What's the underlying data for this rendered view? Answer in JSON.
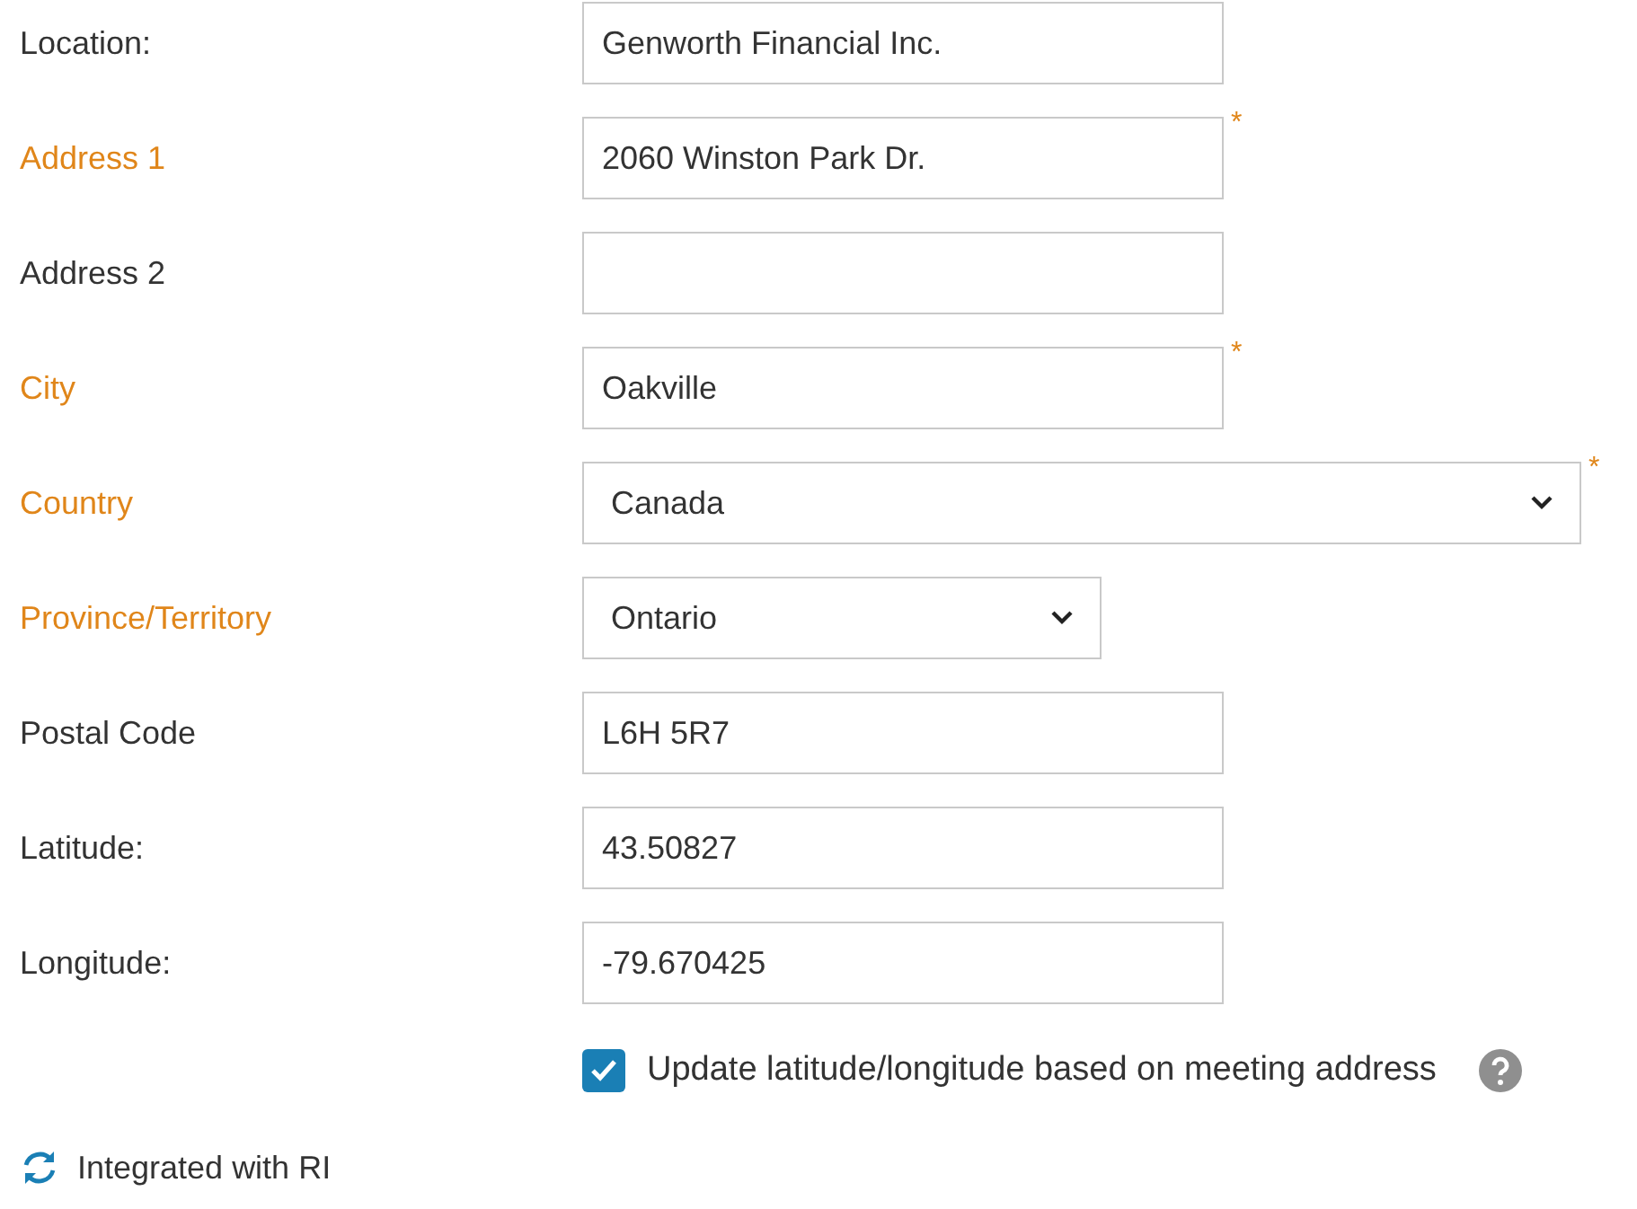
{
  "fields": [
    {
      "label": "Location:",
      "kind": "text",
      "required": false,
      "value": "Genworth Financial Inc."
    },
    {
      "label": "Address 1",
      "kind": "text",
      "required": true,
      "marker": "*",
      "value": "2060 Winston Park Dr."
    },
    {
      "label": "Address 2",
      "kind": "text",
      "required": false
    },
    {
      "label": "City",
      "kind": "text",
      "required": true,
      "marker": "*",
      "value": "Oakville"
    },
    {
      "label": "Country",
      "kind": "wideselect",
      "required": true,
      "marker": "*",
      "value": "Canada"
    },
    {
      "label": "Province/Territory",
      "kind": "select",
      "required": true,
      "value": "Ontario"
    },
    {
      "label": "Postal Code",
      "kind": "text",
      "required": false,
      "value": "L6H 5R7"
    },
    {
      "label": "Latitude:",
      "kind": "text",
      "required": false,
      "value": "43.50827"
    },
    {
      "label": "Longitude:",
      "kind": "text",
      "required": false,
      "value": "-79.670425"
    }
  ],
  "update_option": {
    "label": "Update latitude/longitude based on meeting address",
    "checked": true
  },
  "integration": {
    "label": "Integrated with RI"
  }
}
